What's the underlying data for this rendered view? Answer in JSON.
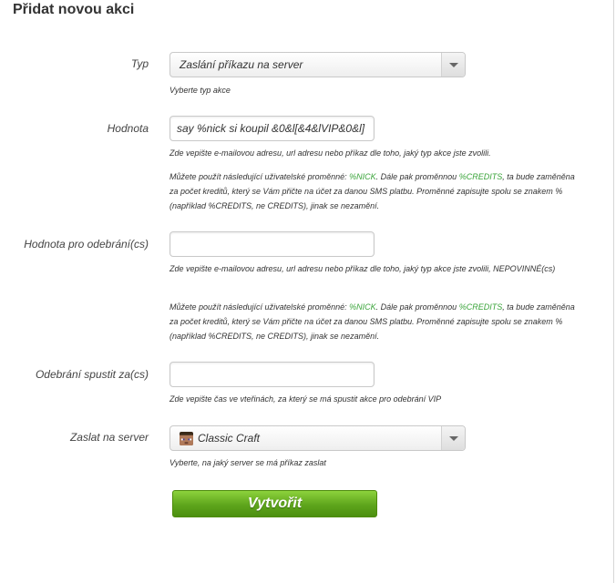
{
  "page": {
    "title": "Přidat novou akci"
  },
  "type_field": {
    "label": "Typ",
    "selected": "Zaslání příkazu na server",
    "hint": "Vyberte typ akce"
  },
  "value_field": {
    "label": "Hodnota",
    "value": "say %nick si koupil &0&l[&4&lVIP&0&l]",
    "hint1": "Zde vepište e-mailovou adresu, url adresu nebo příkaz dle toho, jaký typ akce jste zvolili.",
    "hint2_a": "Můžete použít následující uživatelské proměnné: ",
    "hint2_var1": "%NICK",
    "hint2_b": ". Dále pak proměnnou ",
    "hint2_var2": "%CREDITS",
    "hint2_c": ", ta bude zaměněna za počet kreditů, který se Vám přičte na účet za danou SMS platbu. Proměnné zapisujte spolu se znakem % (například %CREDITS, ne CREDITS), jinak se nezamění."
  },
  "remove_value_field": {
    "label": "Hodnota pro odebrání(cs)",
    "value": "",
    "hint1": "Zde vepište e-mailovou adresu, url adresu nebo příkaz dle toho, jaký typ akce jste zvolili, NEPOVINNÉ(cs)",
    "hint2_a": "Můžete použít následující uživatelské proměnné: ",
    "hint2_var1": "%NICK",
    "hint2_b": ". Dále pak proměnnou ",
    "hint2_var2": "%CREDITS",
    "hint2_c": ", ta bude zaměněna za počet kreditů, který se Vám přičte na účet za danou SMS platbu. Proměnné zapisujte spolu se znakem % (například %CREDITS, ne CREDITS), jinak se nezamění."
  },
  "remove_delay_field": {
    "label": "Odebrání spustit za(cs)",
    "value": "",
    "hint": "Zde vepište čas ve vteřinách, za který se má spustit akce pro odebrání VIP"
  },
  "server_field": {
    "label": "Zaslat na server",
    "selected": "Classic Craft",
    "icon": "minecraft-head-icon",
    "hint": "Vyberte, na jaký server se má příkaz zaslat"
  },
  "submit": {
    "label": "Vytvořit"
  },
  "colors": {
    "accent_green": "#5ea51c",
    "variable_green": "#3aa43a"
  }
}
